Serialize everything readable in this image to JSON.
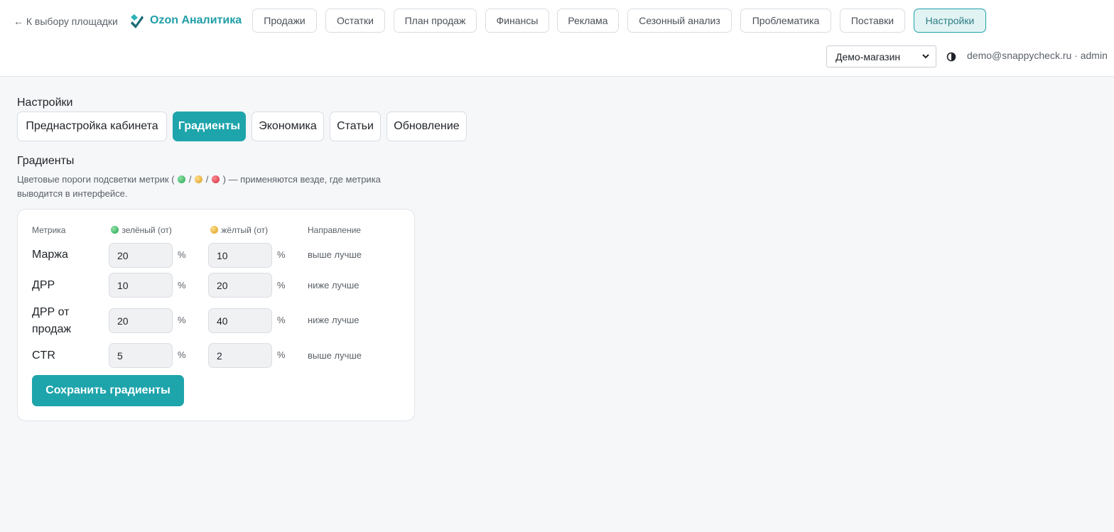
{
  "header": {
    "back_link": "← К выбору площадки",
    "brand": "Ozon Аналитика",
    "brand_color": "#1f9ea6",
    "nav": [
      "Продажи",
      "Остатки",
      "План продаж",
      "Финансы",
      "Реклама",
      "Сезонный анализ",
      "Проблематика",
      "Поставки",
      "Настройки"
    ],
    "active_nav": "Настройки",
    "store_select": "Демо-магазин",
    "theme_toggle_icon": "half-circle-contrast-icon",
    "user": "demo@snappycheck.ru · admin"
  },
  "settings": {
    "title": "Настройки",
    "tabs": [
      "Преднастройка кабинета",
      "Градиенты",
      "Экономика",
      "Статьи",
      "Обновление"
    ],
    "active_tab": "Градиенты"
  },
  "gradients": {
    "title": "Градиенты",
    "desc_before": "Цветовые пороги подсветки метрик (",
    "desc_sep": "/",
    "desc_after": ") — применяются везде, где метрика выводится в интерфейсе.",
    "columns": {
      "metric": "Метрика",
      "green": "зелёный (от)",
      "yellow": "жёлтый (от)",
      "direction": "Направление"
    },
    "rows": [
      {
        "metric": "Маржа",
        "green": "20",
        "yellow": "10",
        "unit": "%",
        "direction": "выше лучше"
      },
      {
        "metric": "ДРР",
        "green": "10",
        "yellow": "20",
        "unit": "%",
        "direction": "ниже лучше"
      },
      {
        "metric": "ДРР от продаж",
        "green": "20",
        "yellow": "40",
        "unit": "%",
        "direction": "ниже лучше"
      },
      {
        "metric": "CTR",
        "green": "5",
        "yellow": "2",
        "unit": "%",
        "direction": "выше лучше"
      }
    ],
    "save_label": "Сохранить градиенты",
    "colors": {
      "accent": "#1ea4ab",
      "green": "#22a350",
      "yellow": "#d99a1a",
      "red": "#d02a3a"
    }
  }
}
